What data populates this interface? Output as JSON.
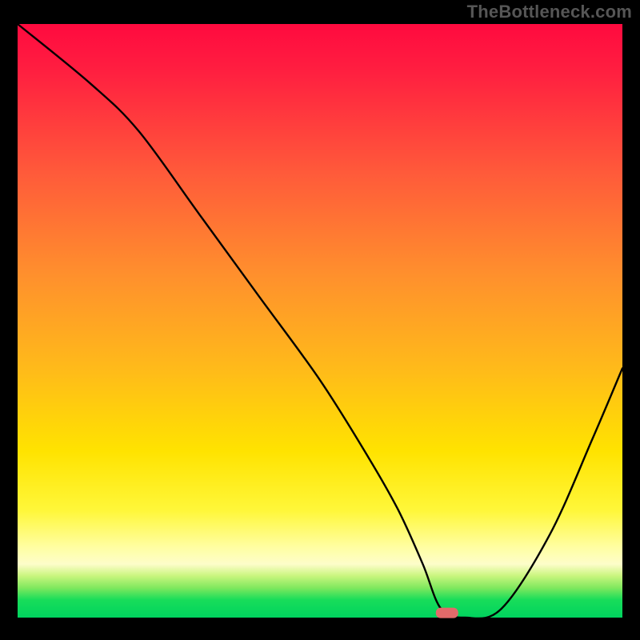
{
  "watermark": "TheBottleneck.com",
  "chart_data": {
    "type": "line",
    "title": "",
    "xlabel": "",
    "ylabel": "",
    "xlim": [
      0,
      100
    ],
    "ylim": [
      0,
      100
    ],
    "series": [
      {
        "name": "bottleneck-curve",
        "x": [
          0,
          12,
          20,
          30,
          40,
          50,
          58,
          63,
          67,
          70,
          74,
          80,
          88,
          95,
          100
        ],
        "y": [
          100,
          90,
          82,
          68,
          54,
          40,
          27,
          18,
          9,
          1.5,
          0,
          1.5,
          14,
          30,
          42
        ]
      }
    ],
    "marker": {
      "x": 71,
      "y": 0.8,
      "color": "#e36a6a",
      "shape": "pill"
    },
    "gradient_colors": {
      "top": "#ff0a3f",
      "mid_orange": "#ff8f2d",
      "mid_yellow": "#ffe300",
      "bottom_green": "#00d35e"
    }
  }
}
